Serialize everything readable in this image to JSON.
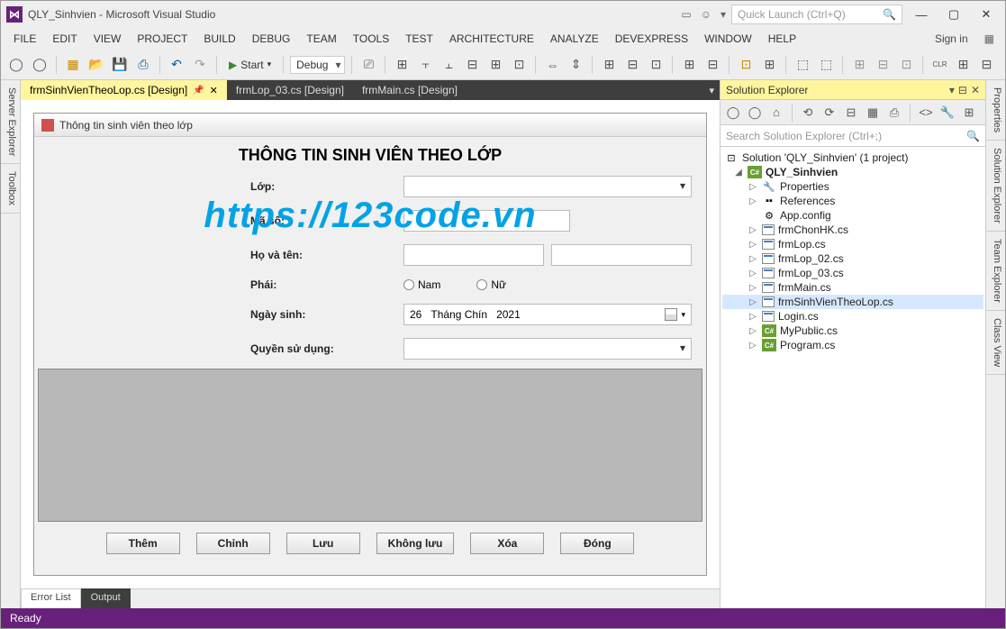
{
  "window": {
    "title": "QLY_Sinhvien - Microsoft Visual Studio",
    "quick_launch_placeholder": "Quick Launch (Ctrl+Q)",
    "signin": "Sign in"
  },
  "menu": [
    "FILE",
    "EDIT",
    "VIEW",
    "PROJECT",
    "BUILD",
    "DEBUG",
    "TEAM",
    "TOOLS",
    "TEST",
    "ARCHITECTURE",
    "ANALYZE",
    "DEVEXPRESS",
    "WINDOW",
    "HELP"
  ],
  "toolbar": {
    "start": "Start",
    "config": "Debug"
  },
  "left_rail": [
    "Server Explorer",
    "Toolbox"
  ],
  "right_rail": [
    "Properties",
    "Solution Explorer",
    "Team Explorer",
    "Class View"
  ],
  "doc_tabs": [
    {
      "label": "frmSinhVienTheoLop.cs [Design]",
      "active": true
    },
    {
      "label": "frmLop_03.cs [Design]",
      "active": false
    },
    {
      "label": "frmMain.cs [Design]",
      "active": false
    }
  ],
  "form": {
    "title": "Thông tin sinh viên theo lớp",
    "heading": "THÔNG TIN SINH VIÊN THEO LỚP",
    "watermark": "https://123code.vn",
    "labels": {
      "lop": "Lớp:",
      "maso": "Mã số:",
      "hoten": "Họ và tên:",
      "phai": "Phái:",
      "ngaysinh": "Ngày sinh:",
      "quyen": "Quyền sử dụng:"
    },
    "radios": {
      "nam": "Nam",
      "nu": "Nữ"
    },
    "date": {
      "day": "26",
      "month": "Tháng Chín",
      "year": "2021"
    },
    "buttons": [
      "Thêm",
      "Chỉnh",
      "Lưu",
      "Không lưu",
      "Xóa",
      "Đóng"
    ]
  },
  "bottom_tabs": {
    "error_list": "Error List",
    "output": "Output"
  },
  "solution_explorer": {
    "title": "Solution Explorer",
    "search_placeholder": "Search Solution Explorer (Ctrl+;)",
    "solution": "Solution 'QLY_Sinhvien' (1 project)",
    "project": "QLY_Sinhvien",
    "items": [
      {
        "label": "Properties",
        "icon": "wrench"
      },
      {
        "label": "References",
        "icon": "refs"
      },
      {
        "label": "App.config",
        "icon": "config"
      },
      {
        "label": "frmChonHK.cs",
        "icon": "form"
      },
      {
        "label": "frmLop.cs",
        "icon": "form"
      },
      {
        "label": "frmLop_02.cs",
        "icon": "form"
      },
      {
        "label": "frmLop_03.cs",
        "icon": "form"
      },
      {
        "label": "frmMain.cs",
        "icon": "form"
      },
      {
        "label": "frmSinhVienTheoLop.cs",
        "icon": "form",
        "selected": true
      },
      {
        "label": "Login.cs",
        "icon": "form"
      },
      {
        "label": "MyPublic.cs",
        "icon": "cs"
      },
      {
        "label": "Program.cs",
        "icon": "cs"
      }
    ]
  },
  "statusbar": {
    "ready": "Ready"
  }
}
